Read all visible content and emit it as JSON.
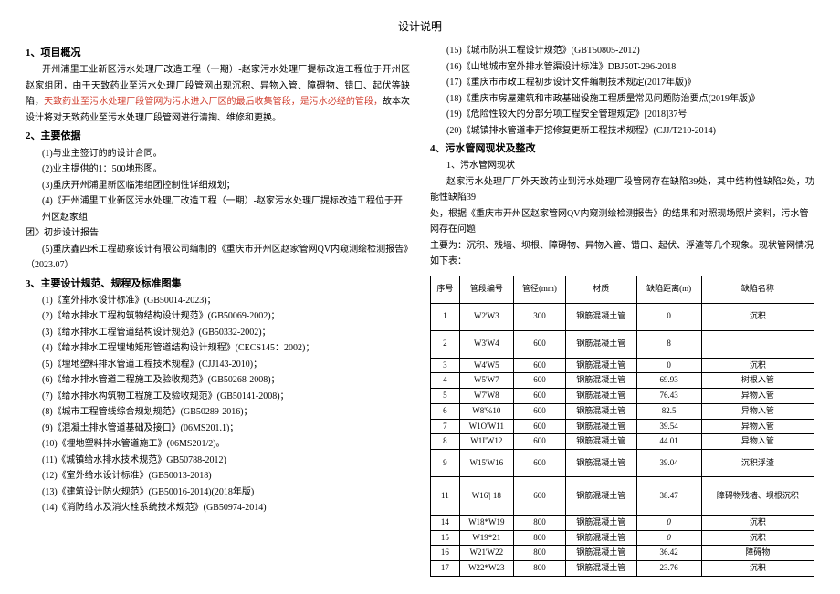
{
  "title": "设计说明",
  "sec1": {
    "heading": "1、项目概况",
    "p1a": "开州浦里工业新区污水处理厂改造工程（一期）-赵家污水处理厂提标改造工程位于开州区赵家组团，由于天致药业至污水处理厂段管网出现沉积、异物入管、障碍物、错口、起伏等缺陷，",
    "p1b": "天致药业至污水处理厂段管网为污水进入厂区的最后收集管段，是污水必经的管段，",
    "p1c": "故本次设计将对天致药业至污水处理厂段管网进行清掏、维修和更换。"
  },
  "sec2": {
    "heading": "2、主要依据",
    "items": [
      "(1)与业主签订的的设计合同。",
      "(2)业主提供的1：500地形图。",
      "(3)重庆开州浦里新区临港组团控制性详细规划；",
      "(4)《开州浦里工业新区污水处理厂改造工程（一期）-赵家污水处理厂提标改造工程位于开州区赵家组",
      "(5)重庆鑫四禾工程勘察设计有限公司编制的《重庆市开州区赵家管网QV内窥测绘检测报告》"
    ],
    "item4_tail": "团》初步设计报告",
    "item5_tail": "（2023.07）"
  },
  "sec3": {
    "heading": "3、主要设计规范、规程及标准图集",
    "left_items": [
      "(1)《室外排水设计标准》(GB50014-2023)；",
      "(2)《给水排水工程构筑物结构设计规范》(GB50069-2002)；",
      "(3)《给水排水工程管道结构设计规范》(GB50332-2002)；",
      "(4)《给水排水工程埋地矩形管道结构设计规程》(CECS145：2002)；",
      "(5)《埋地塑料排水管道工程技术规程》(CJJ143-2010)；",
      "(6)《给水排水管道工程施工及验收规范》(GB50268-2008)；",
      "(7)《给水排水构筑物工程施工及验收规范》(GB50141-2008)；",
      "(8)《城市工程管线综合规划规范》(GB50289-2016)；",
      "(9)《混凝土排水管道基础及接口》(06MS201.1)；",
      "(10)《埋地塑料排水管道施工》(06MS201/2)。",
      "(11)《城镇给水排水技术规范》GB50788-2012)",
      "(12)《室外给水设计标准》(GB50013-2018)",
      "(13)《建筑设计防火规范》(GB50016-2014)(2018年版)",
      "(14)《消防给水及消火栓系统技术规范》(GB50974-2014)"
    ],
    "right_items": [
      "(15)《城市防洪工程设计规范》(GBT50805-2012)",
      "(16)《山地城市室外排水管渠设计标准》DBJ50T-296-2018",
      "(17)《重庆市市政工程初步设计文件编制技术规定(2017年版)》",
      "(18)《重庆市房屋建筑和市政基础设施工程质量常见问题防治要点(2019年版)》",
      "(19)《危险性较大的分部分项工程安全管理规定》[2018]37号",
      "(20)《城镇排水管道非开挖修复更新工程技术规程》(CJJ/T210-2014)"
    ]
  },
  "sec4": {
    "heading": "4、污水管网现状及整改",
    "sub1": "1、污水管网现状",
    "p1": "赵家污水处理厂厂外天致药业到污水处理厂段管网存在缺陷39处，其中结构性缺陷2处，功能性缺陷39",
    "p2": "处，根据《重庆市开州区赵家管网QV内窥测绘检测报告》的结果和对照现场照片资料，污水管网存在问题",
    "p3": "主要为：沉积、残墙、坝根、障碍物、异物入管、错口、起伏、浮渣等几个现象。现状管网情况如下表："
  },
  "table": {
    "headers": [
      "序号",
      "管段编号",
      "管径(mm)",
      "材质",
      "缺陷距离(m)",
      "缺陷名称"
    ],
    "rows": [
      [
        "1",
        "W2'W3",
        "300",
        "钢筋混凝土管",
        "0",
        "沉积"
      ],
      [
        "2",
        "W3'W4",
        "600",
        "钢筋混凝土管",
        "8",
        ""
      ],
      [
        "3",
        "W4'W5",
        "600",
        "钢筋混凝土管",
        "0",
        "沉积"
      ],
      [
        "4",
        "W5'W7",
        "600",
        "钢筋混凝土管",
        "69.93",
        "树根入管"
      ],
      [
        "5",
        "W7'W8",
        "600",
        "钢筋混凝土管",
        "76.43",
        "异物入管"
      ],
      [
        "6",
        "W8'%10",
        "600",
        "钢筋混凝土管",
        "82.5",
        "异物入管"
      ],
      [
        "7",
        "W1O'W11",
        "600",
        "钢筋混凝土管",
        "39.54",
        "异物入管"
      ],
      [
        "8",
        "W1I'W12",
        "600",
        "钢筋混凝土管",
        "44.01",
        "异物入管"
      ],
      [
        "9",
        "W15'W16",
        "600",
        "钢筋混凝土管",
        "39.04",
        "沉积浮渣"
      ],
      [
        "11",
        "W16'| 18",
        "600",
        "钢筋混凝土管",
        "38.47",
        "障碍物残墙、坝根沉积"
      ],
      [
        "14",
        "W18*W19",
        "800",
        "钢筋混凝土管",
        "0",
        "沉积"
      ],
      [
        "15",
        "W19*21",
        "800",
        "钢筋混凝土管",
        "0",
        "沉积"
      ],
      [
        "16",
        "W21'W22",
        "800",
        "钢筋混凝土管",
        "36.42",
        "障碍物"
      ],
      [
        "17",
        "W22*W23",
        "800",
        "钢筋混凝土管",
        "23.76",
        "沉积"
      ]
    ]
  }
}
